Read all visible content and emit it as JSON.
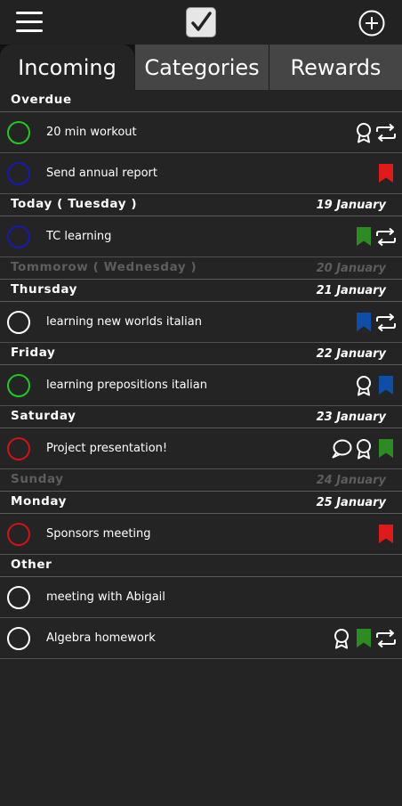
{
  "colors": {
    "green": "#21c821",
    "blue": "#1818b4",
    "red": "#d11313",
    "white": "#ffffff",
    "flag_red": "#e01a1a",
    "flag_green": "#2c8c22",
    "flag_blue": "#0f4ea6"
  },
  "tabs": [
    {
      "label": "Incoming",
      "active": true
    },
    {
      "label": "Categories",
      "active": false
    },
    {
      "label": "Rewards",
      "active": false
    }
  ],
  "sections": [
    {
      "name": "Overdue",
      "date": "",
      "tasks": [
        {
          "title": "20 min workout",
          "circle": "green",
          "icons": [
            "award-icon",
            "repeat-icon"
          ]
        },
        {
          "title": "Send annual report",
          "circle": "blue",
          "icons": [
            "flag-red-icon"
          ]
        }
      ]
    },
    {
      "name": "Today ( Tuesday )",
      "date": "19 January",
      "tasks": [
        {
          "title": "TC learning",
          "circle": "blue",
          "icons": [
            "flag-green-icon",
            "repeat-icon"
          ]
        }
      ]
    },
    {
      "name": "Tommorow ( Wednesday )",
      "date": "20 January",
      "tasks": []
    },
    {
      "name": "Thursday",
      "date": "21 January",
      "tasks": [
        {
          "title": "learning new worlds italian",
          "circle": "white",
          "icons": [
            "flag-blue-icon",
            "repeat-icon"
          ]
        }
      ]
    },
    {
      "name": "Friday",
      "date": "22 January",
      "tasks": [
        {
          "title": "learning prepositions italian",
          "circle": "green",
          "icons": [
            "award-icon",
            "flag-blue-icon"
          ]
        }
      ]
    },
    {
      "name": "Saturday",
      "date": "23 January",
      "tasks": [
        {
          "title": "Project presentation!",
          "circle": "red",
          "icons": [
            "comment-icon",
            "award-icon",
            "flag-green-icon"
          ]
        }
      ]
    },
    {
      "name": "Sunday",
      "date": "24 January",
      "tasks": []
    },
    {
      "name": "Monday",
      "date": "25 January",
      "tasks": [
        {
          "title": "Sponsors meeting",
          "circle": "red",
          "icons": [
            "flag-red-icon"
          ]
        }
      ]
    },
    {
      "name": "Other",
      "date": "",
      "tasks": [
        {
          "title": "meeting with Abigail",
          "circle": "white",
          "icons": []
        },
        {
          "title": "Algebra homework",
          "circle": "white",
          "icons": [
            "award-icon",
            "flag-green-icon",
            "repeat-icon"
          ]
        }
      ]
    }
  ]
}
